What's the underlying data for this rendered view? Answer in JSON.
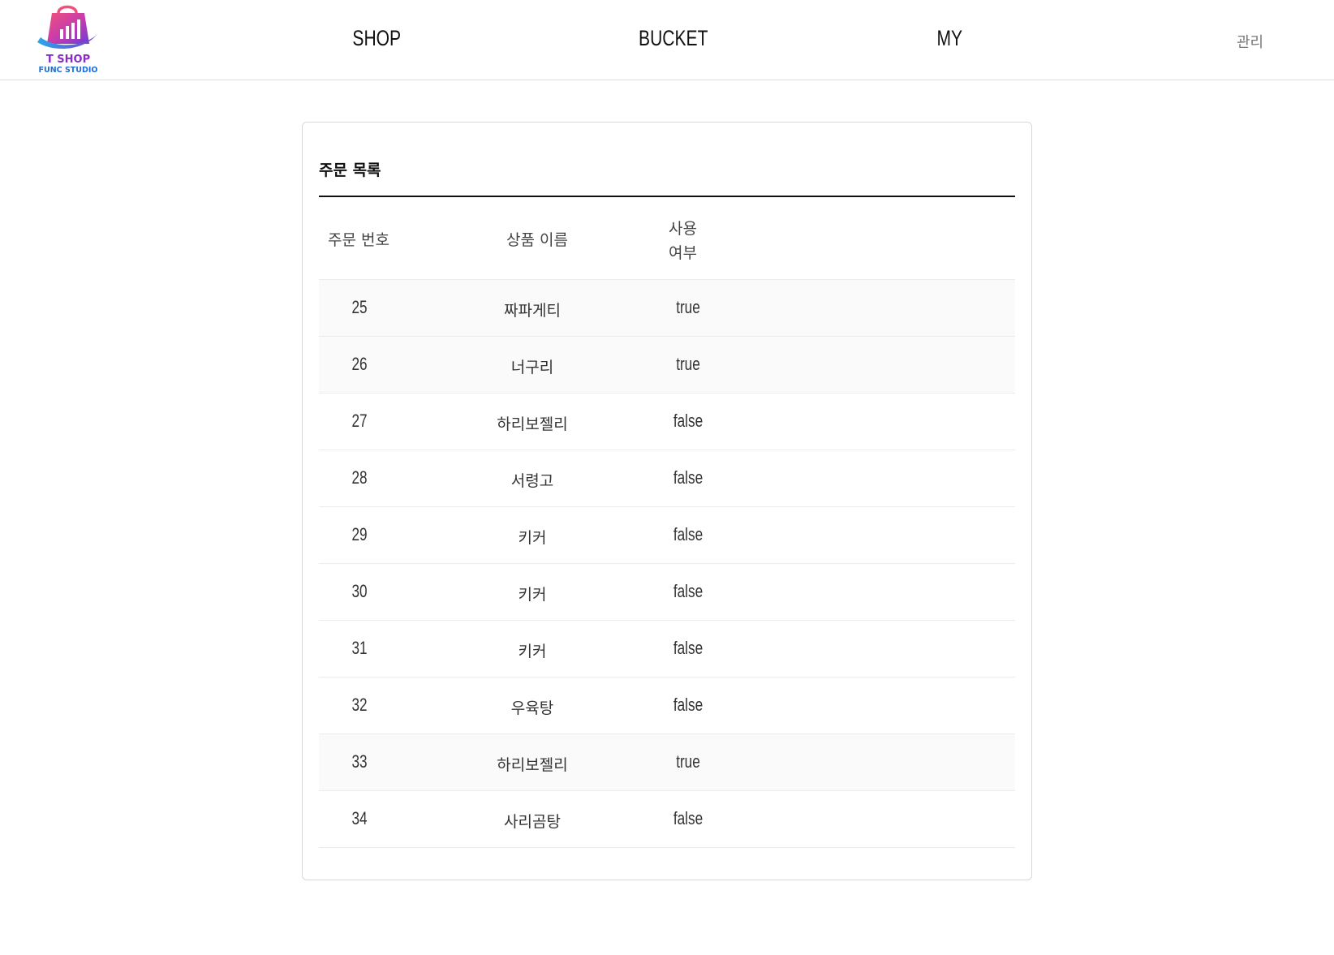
{
  "brand": {
    "line1": "T SHOP",
    "line2": "FUNC STUDIO"
  },
  "nav": {
    "shop": "SHOP",
    "bucket": "BUCKET",
    "my": "MY",
    "admin": "관리"
  },
  "orders": {
    "title": "주문 목록",
    "columns": {
      "order_no": "주문 번호",
      "product_name": "상품 이름",
      "used_line1": "사용",
      "used_line2": "여부"
    },
    "rows": [
      {
        "no": "25",
        "name": "짜파게티",
        "used": "true"
      },
      {
        "no": "26",
        "name": "너구리",
        "used": "true"
      },
      {
        "no": "27",
        "name": "하리보젤리",
        "used": "false"
      },
      {
        "no": "28",
        "name": "서령고",
        "used": "false"
      },
      {
        "no": "29",
        "name": "키커",
        "used": "false"
      },
      {
        "no": "30",
        "name": "키커",
        "used": "false"
      },
      {
        "no": "31",
        "name": "키커",
        "used": "false"
      },
      {
        "no": "32",
        "name": "우육탕",
        "used": "false"
      },
      {
        "no": "33",
        "name": "하리보젤리",
        "used": "true"
      },
      {
        "no": "34",
        "name": "사리곰탕",
        "used": "false"
      }
    ]
  },
  "colors": {
    "logo_pink": "#e83f7a",
    "logo_purple": "#8a2cc8",
    "logo_blue": "#1e6fd9",
    "row_shade": "#fafafa"
  }
}
